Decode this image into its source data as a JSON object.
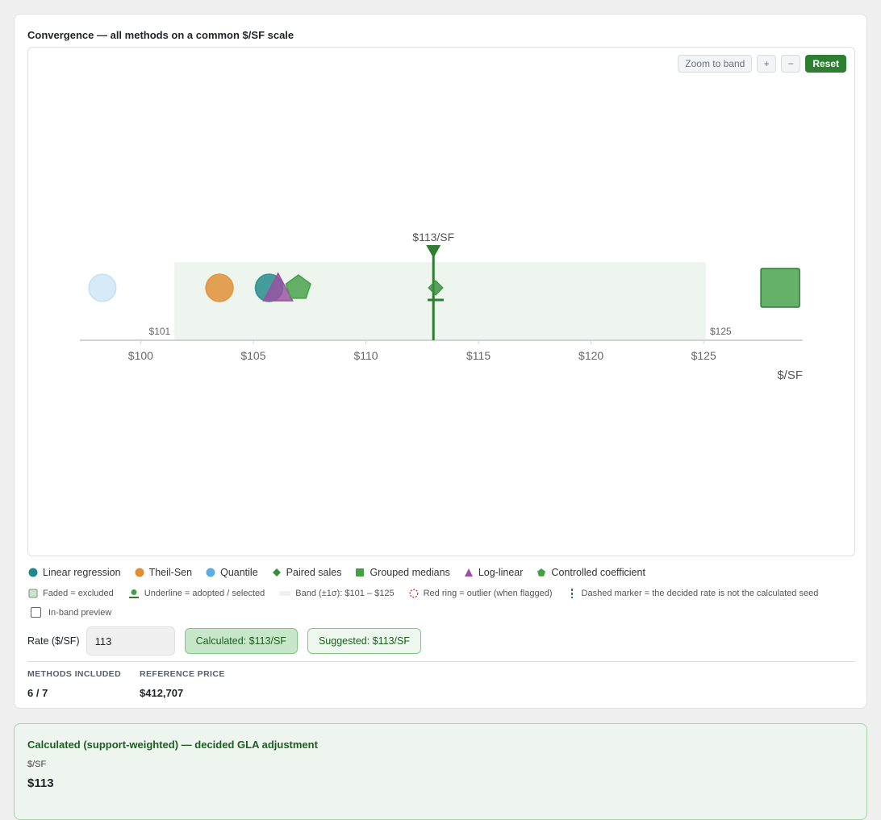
{
  "card": {
    "title": "Convergence — all methods on a common $/SF scale"
  },
  "toolbar": {
    "zoom_label": "Zoom to band",
    "plus_label": "+",
    "minus_label": "−",
    "reset_label": "Reset"
  },
  "chart_data": {
    "type": "scatter",
    "x_unit": "$/SF",
    "xlabel": "$/SF",
    "xlim": [
      97.3,
      129.4
    ],
    "x_ticks": [
      100,
      105,
      110,
      115,
      120,
      125
    ],
    "tick_labels": [
      "$100",
      "$105",
      "$110",
      "$115",
      "$120",
      "$125"
    ],
    "band": {
      "low": 101.5,
      "high": 125.1,
      "low_label": "$101",
      "high_label": "$125",
      "color": "#edf5ee"
    },
    "decided_rate": {
      "value": 113,
      "label": "$113/SF",
      "color": "#2e7d32"
    },
    "points": [
      {
        "method": "Quantile",
        "value": 98.3,
        "shape": "circle",
        "color": "#5dade2",
        "excluded": true
      },
      {
        "method": "Theil-Sen",
        "value": 103.5,
        "shape": "circle",
        "color": "#e08e2f",
        "excluded": false
      },
      {
        "method": "Linear regression",
        "value": 105.7,
        "shape": "circle",
        "color": "#1f8a8a",
        "excluded": false
      },
      {
        "method": "Log-linear",
        "value": 106.1,
        "shape": "triangle",
        "color": "#9b4fa3",
        "excluded": false
      },
      {
        "method": "Controlled coefficient",
        "value": 107.0,
        "shape": "pentagon",
        "color": "#43a047",
        "excluded": false
      },
      {
        "method": "Paired sales",
        "value": 113.1,
        "shape": "diamond",
        "color": "#388e3c",
        "excluded": false
      },
      {
        "method": "Grouped medians",
        "value": 128.4,
        "shape": "square",
        "color": "#43a047",
        "excluded": false
      }
    ]
  },
  "legend": {
    "items": [
      {
        "label": "Linear regression",
        "shape": "circle",
        "color": "#1f8a8a"
      },
      {
        "label": "Theil-Sen",
        "shape": "circle",
        "color": "#e08e2f"
      },
      {
        "label": "Quantile",
        "shape": "circle",
        "color": "#5dade2"
      },
      {
        "label": "Paired sales",
        "shape": "diamond",
        "color": "#388e3c"
      },
      {
        "label": "Grouped medians",
        "shape": "square",
        "color": "#43a047"
      },
      {
        "label": "Log-linear",
        "shape": "triangle",
        "color": "#9b4fa3"
      },
      {
        "label": "Controlled coefficient",
        "shape": "pentagon",
        "color": "#43a047"
      }
    ],
    "notes": [
      {
        "label": "Faded = excluded",
        "icon": "faded-swatch-icon"
      },
      {
        "label": "Underline = adopted / selected",
        "icon": "underline-icon"
      },
      {
        "label": "Band (±1σ): $101 – $125",
        "icon": "band-swatch-icon"
      },
      {
        "label": "Red ring = outlier (when flagged)",
        "icon": "red-ring-icon"
      },
      {
        "label": "Dashed marker = the decided rate is not the calculated seed",
        "icon": "dashed-marker-icon"
      }
    ],
    "preview_label": "In-band preview"
  },
  "rate": {
    "label": "Rate ($/SF)",
    "value": "113",
    "calculated_label": "Calculated: $113/SF",
    "suggested_label": "Suggested: $113/SF"
  },
  "stats": {
    "methods_label": "METHODS INCLUDED",
    "methods_value": "6 / 7",
    "ref_label": "REFERENCE PRICE",
    "ref_value": "$412,707"
  },
  "summary": {
    "title": "Calculated (support-weighted) — decided GLA adjustment",
    "unit_label": "$/SF",
    "value": "$113"
  }
}
